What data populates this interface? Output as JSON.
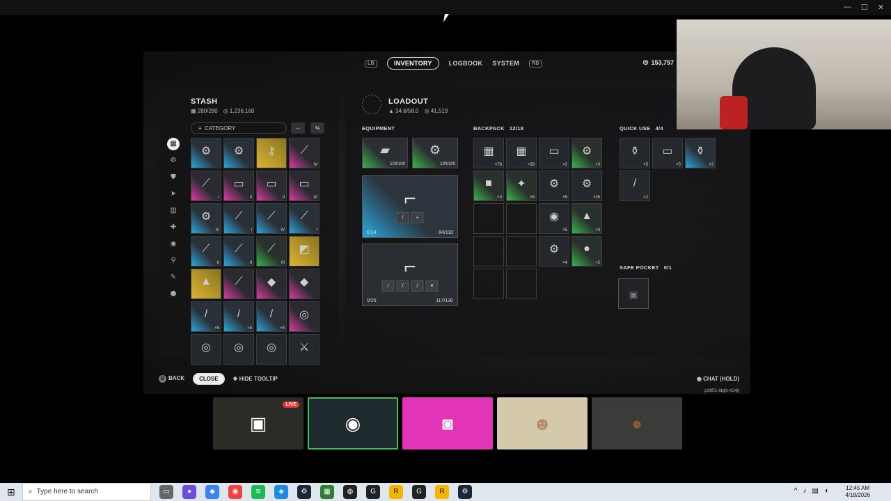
{
  "window": {
    "controls": [
      "—",
      "☐",
      "✕"
    ]
  },
  "tabs": {
    "left_hint": "LB",
    "right_hint": "RB",
    "items": [
      "INVENTORY",
      "LOGBOOK",
      "SYSTEM"
    ],
    "active": "INVENTORY"
  },
  "currency": {
    "value": "153,757"
  },
  "stash": {
    "title": "STASH",
    "slots": "280/280",
    "value": "1,236,160",
    "category_label": "CATEGORY",
    "cells": [
      {
        "c": "blue",
        "i": "⚙",
        "n": ""
      },
      {
        "c": "blue",
        "i": "⚙",
        "n": ""
      },
      {
        "c": "gold",
        "i": "⚷",
        "n": ""
      },
      {
        "c": "pink",
        "i": "⟋",
        "n": "IV"
      },
      {
        "c": "pink",
        "i": "⟋",
        "n": "I"
      },
      {
        "c": "pink",
        "i": "▭",
        "n": "II"
      },
      {
        "c": "pink",
        "i": "▭",
        "n": "II"
      },
      {
        "c": "pink",
        "i": "▭",
        "n": "IV"
      },
      {
        "c": "blue",
        "i": "⚙",
        "n": "IV"
      },
      {
        "c": "blue",
        "i": "⟋",
        "n": "I"
      },
      {
        "c": "blue",
        "i": "⟋",
        "n": "IV"
      },
      {
        "c": "blue",
        "i": "⟋",
        "n": "I"
      },
      {
        "c": "blue",
        "i": "⟋",
        "n": "II"
      },
      {
        "c": "blue",
        "i": "⟋",
        "n": "II"
      },
      {
        "c": "green",
        "i": "⟋",
        "n": "III"
      },
      {
        "c": "gold",
        "i": "◩",
        "n": ""
      },
      {
        "c": "gold",
        "i": "▲",
        "n": ""
      },
      {
        "c": "pink",
        "i": "⟋",
        "n": ""
      },
      {
        "c": "pink",
        "i": "◆",
        "n": ""
      },
      {
        "c": "pink",
        "i": "◆",
        "n": ""
      },
      {
        "c": "blue",
        "i": "/",
        "n": "×5"
      },
      {
        "c": "blue",
        "i": "/",
        "n": "×5"
      },
      {
        "c": "blue",
        "i": "/",
        "n": "×5"
      },
      {
        "c": "pink",
        "i": "◎",
        "n": ""
      },
      {
        "c": "plain",
        "i": "◎",
        "n": ""
      },
      {
        "c": "plain",
        "i": "◎",
        "n": ""
      },
      {
        "c": "plain",
        "i": "◎",
        "n": ""
      },
      {
        "c": "plain",
        "i": "⚔",
        "n": ""
      }
    ]
  },
  "loadout": {
    "title": "LOADOUT",
    "weight": "34.6/58.0",
    "value": "41,519",
    "equipment_label": "EQUIPMENT",
    "augment_durability": "100/100",
    "shield_durability": "100/100",
    "weapon1": {
      "ammo": "0/14",
      "mag": "84/110"
    },
    "weapon2": {
      "ammo": "0/25",
      "mag": "117/130"
    },
    "backpack_label": "BACKPACK",
    "backpack_count": "12/18",
    "backpack": [
      {
        "c": "plain",
        "i": "▦",
        "n": "×78"
      },
      {
        "c": "plain",
        "i": "▦",
        "n": "×38"
      },
      {
        "c": "plain",
        "i": "▭",
        "n": "×2"
      },
      {
        "c": "green",
        "i": "⚙",
        "n": "×3"
      },
      {
        "c": "green",
        "i": "■",
        "n": "×3"
      },
      {
        "c": "green",
        "i": "✦",
        "n": "×5"
      },
      {
        "c": "plain",
        "i": "⚙",
        "n": "×5"
      },
      {
        "c": "plain",
        "i": "⚙",
        "n": "×35"
      },
      {
        "c": "empty",
        "i": "",
        "n": ""
      },
      {
        "c": "empty",
        "i": "",
        "n": ""
      },
      {
        "c": "plain",
        "i": "◉",
        "n": "×5"
      },
      {
        "c": "green",
        "i": "▲",
        "n": "×3"
      },
      {
        "c": "empty",
        "i": "",
        "n": ""
      },
      {
        "c": "empty",
        "i": "",
        "n": ""
      },
      {
        "c": "plain",
        "i": "⚙",
        "n": "×4"
      },
      {
        "c": "green",
        "i": "●",
        "n": "×2"
      },
      {
        "c": "empty",
        "i": "",
        "n": ""
      },
      {
        "c": "empty",
        "i": "",
        "n": ""
      }
    ],
    "quick_label": "QUICK USE",
    "quick_count": "4/4",
    "quick": [
      {
        "c": "plain",
        "i": "⚱",
        "n": "×5"
      },
      {
        "c": "plain",
        "i": "▭",
        "n": "×5"
      },
      {
        "c": "blue",
        "i": "⚱",
        "n": "×3"
      },
      {
        "c": "plain",
        "i": "/",
        "n": "×2"
      }
    ],
    "safe_label": "SAFE POCKET",
    "safe_count": "0/1"
  },
  "footer": {
    "back": "BACK",
    "close": "CLOSE",
    "hide": "HIDE TOOLTIP",
    "chat": "CHAT (HOLD)",
    "code": "p3851-ldgfx-h24jl"
  },
  "stream_tiles": {
    "live_badge": "LIVE"
  },
  "taskbar": {
    "search_placeholder": "Type here to search",
    "time": "12:45 AM",
    "date": "4/18/2026"
  }
}
